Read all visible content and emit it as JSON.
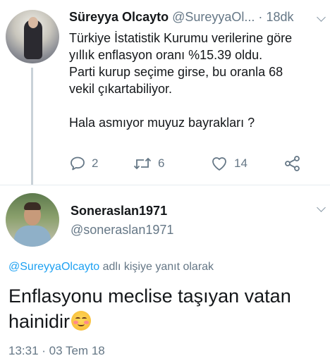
{
  "tweet1": {
    "display_name": "Süreyya Olcayto",
    "handle": "@SureyyaOl...",
    "separator": "·",
    "time": "18dk",
    "lines": [
      "Türkiye İstatistik Kurumu verilerine göre",
      "yıllık enflasyon oranı %15.39 oldu.",
      "Parti kurup seçime girse, bu oranla 68",
      "vekil çıkartabiliyor."
    ],
    "last_line": "Hala asmıyor muyuz bayrakları ?",
    "actions": {
      "reply_count": "2",
      "retweet_count": "6",
      "like_count": "14"
    }
  },
  "tweet2": {
    "display_name": "Soneraslan1971",
    "handle": "@soneraslan1971",
    "replying_to_handle": "@SureyyaOlcayto",
    "replying_suffix": " adlı kişiye yanıt olarak",
    "text_line1": "Enflasyonu meclise taşıyan vatan",
    "text_line2": "hainidir",
    "emoji": "smiling-face-with-blush",
    "timestamp": "13:31 · 03 Tem 18"
  },
  "colors": {
    "text": "#14171a",
    "secondary": "#657786",
    "link": "#1da1f2",
    "divider": "#e6ecf0"
  }
}
